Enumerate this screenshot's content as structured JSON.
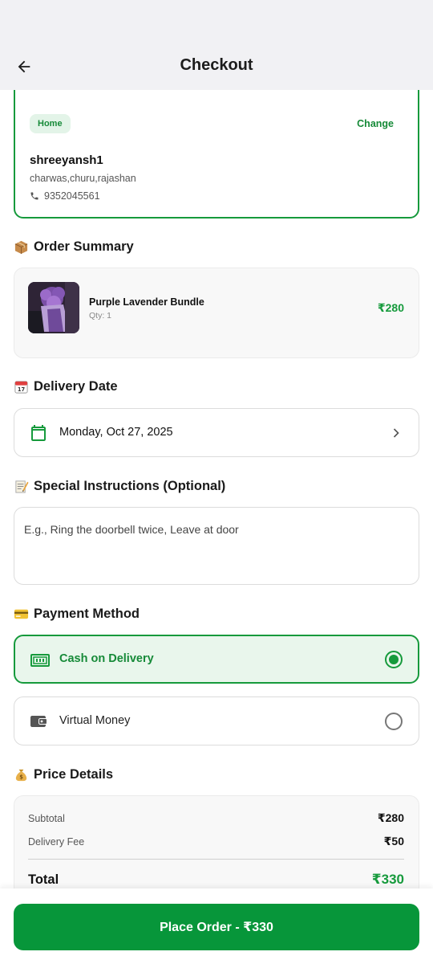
{
  "appbar": {
    "title": "Checkout",
    "back_icon": "arrow-left-icon"
  },
  "address": {
    "badge": "Home",
    "change_label": "Change",
    "name": "shreeyansh1",
    "line": "charwas,churu,rajashan",
    "phone": "9352045561"
  },
  "order_summary": {
    "title": "Order Summary",
    "icon": "package-emoji-icon",
    "item": {
      "name": "Purple Lavender Bundle",
      "qty": "Qty: 1",
      "price": "₹280"
    }
  },
  "delivery": {
    "title": "Delivery Date",
    "icon": "calendar-emoji-icon",
    "date": "Monday, Oct 27, 2025"
  },
  "instructions": {
    "title": "Special Instructions (Optional)",
    "icon": "memo-emoji-icon",
    "placeholder": "E.g., Ring the doorbell twice, Leave at door"
  },
  "payment": {
    "title": "Payment Method",
    "icon": "credit-card-emoji-icon",
    "options": [
      {
        "label": "Cash on Delivery",
        "icon": "cash-icon",
        "selected": true
      },
      {
        "label": "Virtual Money",
        "icon": "wallet-icon",
        "selected": false
      }
    ]
  },
  "price_details": {
    "title": "Price Details",
    "icon": "money-bag-emoji-icon",
    "subtotal_label": "Subtotal",
    "subtotal_value": "₹280",
    "delivery_fee_label": "Delivery Fee",
    "delivery_fee_value": "₹50",
    "total_label": "Total",
    "total_value": "₹330"
  },
  "cta": {
    "label": "Place Order - ₹330"
  },
  "colors": {
    "accent": "#169a3c",
    "accent_light": "#e9f6ec",
    "cta": "#07963a",
    "appbar_bg": "#f1f1f4"
  }
}
